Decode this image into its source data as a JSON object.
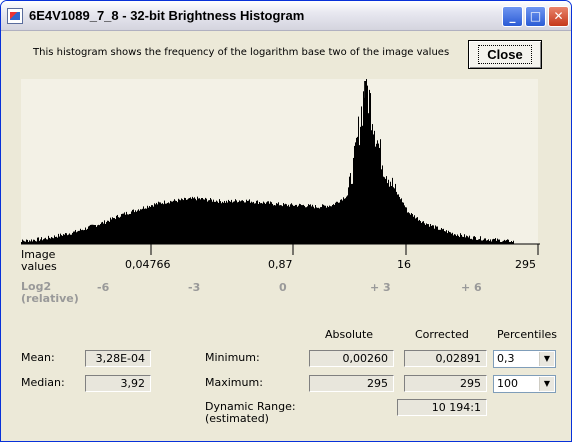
{
  "window": {
    "title": "6E4V1089_7_8 -  32-bit Brightness Histogram",
    "controls": {
      "minimize": "_",
      "maximize": "□",
      "close": "✕"
    }
  },
  "description": "This histogram shows the frequency of the logarithm base two of the image values",
  "close_button": "Close",
  "axis": {
    "image_values_label": "Image\nvalues",
    "image_values_label_line1": "Image",
    "image_values_label_line2": "values",
    "tick_labels": [
      "0,04766",
      "0,87",
      "16",
      "295"
    ],
    "log2_label_line1": "Log2",
    "log2_label_line2": "(relative)",
    "log2_ticks": [
      "-6",
      "-3",
      "0",
      "+ 3",
      "+ 6"
    ]
  },
  "chart_data": {
    "type": "area",
    "title": "",
    "xlabel": "Image values",
    "ylabel": "",
    "x": [
      "0,04766",
      "0,87",
      "16",
      "295"
    ],
    "log2_ticks": [
      "-6",
      "-3",
      "0",
      "+ 3",
      "+ 6"
    ],
    "log2_values": [
      -9.0,
      -8.5,
      -8.0,
      -7.5,
      -7.0,
      -6.5,
      -6.0,
      -5.5,
      -5.0,
      -4.5,
      -4.0,
      -3.5,
      -3.0,
      -2.5,
      -2.0,
      -1.5,
      -1.0,
      -0.5,
      0.0,
      0.5,
      1.0,
      1.5,
      2.0,
      2.2,
      2.4,
      2.6,
      2.8,
      3.0,
      3.2,
      3.4,
      3.6,
      3.8,
      4.0,
      4.5,
      5.0,
      5.5,
      6.0,
      6.5,
      7.0,
      7.5
    ],
    "frequency": [
      0,
      1,
      2,
      4,
      6,
      9,
      12,
      16,
      19,
      22,
      24,
      25,
      26,
      25,
      24,
      25,
      24,
      23,
      22,
      22,
      21,
      22,
      28,
      45,
      70,
      95,
      80,
      60,
      45,
      38,
      30,
      25,
      18,
      12,
      8,
      5,
      3,
      2,
      1,
      0
    ],
    "peak_log2": 2.6,
    "grid": false
  },
  "stats": {
    "headers": {
      "absolute": "Absolute",
      "corrected": "Corrected",
      "percentiles": "Percentiles"
    },
    "mean_label": "Mean:",
    "mean_value": "3,28E-04",
    "median_label": "Median:",
    "median_value": "3,92",
    "minimum_label": "Minimum:",
    "minimum_absolute": "0,00260",
    "minimum_corrected": "0,02891",
    "minimum_percentile": "0,3",
    "maximum_label": "Maximum:",
    "maximum_absolute": "295",
    "maximum_corrected": "295",
    "maximum_percentile": "100",
    "dynamic_range_label_line1": "Dynamic Range:",
    "dynamic_range_label_line2": "(estimated)",
    "dynamic_range_value": "10 194:1"
  }
}
